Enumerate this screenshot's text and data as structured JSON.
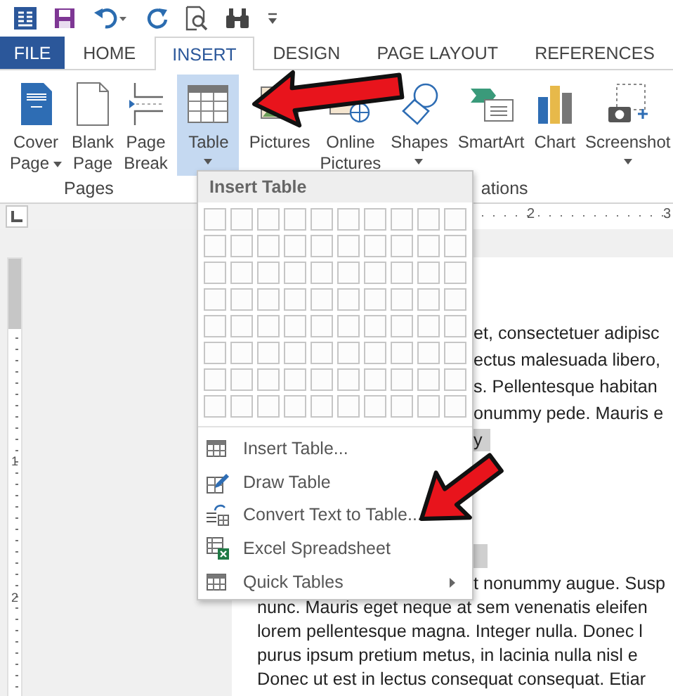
{
  "tabs": [
    {
      "label": "FILE",
      "kind": "file",
      "selected": false
    },
    {
      "label": "HOME",
      "kind": "tab",
      "selected": false
    },
    {
      "label": "INSERT",
      "kind": "tab",
      "selected": true
    },
    {
      "label": "DESIGN",
      "kind": "tab",
      "selected": false
    },
    {
      "label": "PAGE LAYOUT",
      "kind": "tab",
      "selected": false
    },
    {
      "label": "REFERENCES",
      "kind": "tab",
      "selected": false
    }
  ],
  "ribbon": {
    "groups": [
      {
        "label": "Pages",
        "buttons": [
          {
            "label": [
              "Cover",
              "Page"
            ],
            "dropdown": true,
            "pressed": false
          },
          {
            "label": [
              "Blank",
              "Page"
            ],
            "dropdown": false,
            "pressed": false
          },
          {
            "label": [
              "Page",
              "Break"
            ],
            "dropdown": false,
            "pressed": false
          }
        ]
      },
      {
        "buttons": [
          {
            "label": [
              "Table"
            ],
            "dropdown": true,
            "pressed": true
          }
        ]
      },
      {
        "label": "ations",
        "buttons": [
          {
            "label": [
              "Pictures"
            ],
            "dropdown": false,
            "pressed": false
          },
          {
            "label": [
              "Online",
              "Pictures"
            ],
            "dropdown": false,
            "pressed": false
          },
          {
            "label": [
              "Shapes"
            ],
            "dropdown": true,
            "pressed": false
          },
          {
            "label": [
              "SmartArt"
            ],
            "dropdown": false,
            "pressed": false
          },
          {
            "label": [
              "Chart"
            ],
            "dropdown": false,
            "pressed": false
          },
          {
            "label": [
              "Screenshot"
            ],
            "dropdown": true,
            "pressed": false
          }
        ]
      }
    ]
  },
  "ruler": {
    "horizontal_labels": [
      "2",
      "3"
    ],
    "vertical_labels": [
      "1",
      "2"
    ]
  },
  "insert_table_menu": {
    "title": "Insert Table",
    "items": [
      {
        "label": "Insert Table...",
        "submenu": false
      },
      {
        "label": "Draw Table",
        "submenu": false
      },
      {
        "label": "Convert Text to Table...",
        "submenu": false
      },
      {
        "label": "Excel Spreadsheet",
        "submenu": false
      },
      {
        "label": "Quick Tables",
        "submenu": true
      }
    ]
  },
  "document": {
    "upper_lines": [
      {
        "text": "et, consectetuer adipisc",
        "highlighted": false
      },
      {
        "text": "ectus malesuada libero,",
        "highlighted": false
      },
      {
        "text": "s. Pellentesque habitan",
        "highlighted": false
      },
      {
        "text": "onummy pede. Mauris e",
        "highlighted": false
      },
      {
        "text": "y",
        "highlighted": true
      }
    ],
    "lower_lines": [
      {
        "text": "t nonummy augue. Susp",
        "partly_hidden": true
      },
      {
        "text": "nunc. Mauris eget neque at sem venenatis eleifen",
        "partly_hidden": false
      },
      {
        "text": "lorem pellentesque magna. Integer nulla. Donec l",
        "partly_hidden": false
      },
      {
        "text": "purus ipsum pretium metus, in lacinia nulla nisl e",
        "partly_hidden": false
      },
      {
        "text": "Donec ut est in lectus consequat consequat. Etiar",
        "partly_hidden": false
      }
    ]
  }
}
